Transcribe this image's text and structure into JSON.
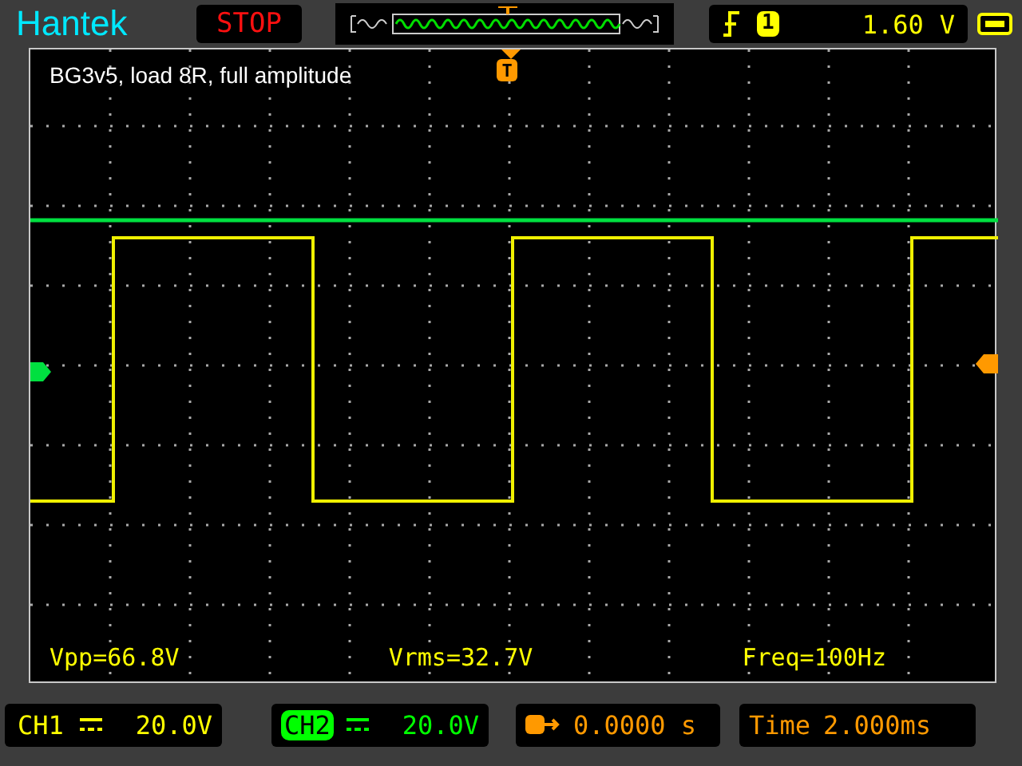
{
  "brand": "Hantek",
  "run_state": "STOP",
  "trigger": {
    "source": "1",
    "level": "1.60",
    "unit": "V",
    "marker": "T"
  },
  "annotation": "BG3v5, load 8R, full amplitude",
  "measurements": [
    {
      "label": "Vpp=66.8V"
    },
    {
      "label": "Vrms=32.7V"
    },
    {
      "label": "Freq=100Hz"
    }
  ],
  "channels": [
    {
      "name": "CH1",
      "scale": "20.0V",
      "color": "#ffff00",
      "selected": false
    },
    {
      "name": "CH2",
      "scale": "20.0V",
      "color": "#00ff00",
      "selected": true
    }
  ],
  "horizontal": {
    "position": "0.0000 s",
    "label": "Time",
    "timebase": "2.000ms"
  }
}
